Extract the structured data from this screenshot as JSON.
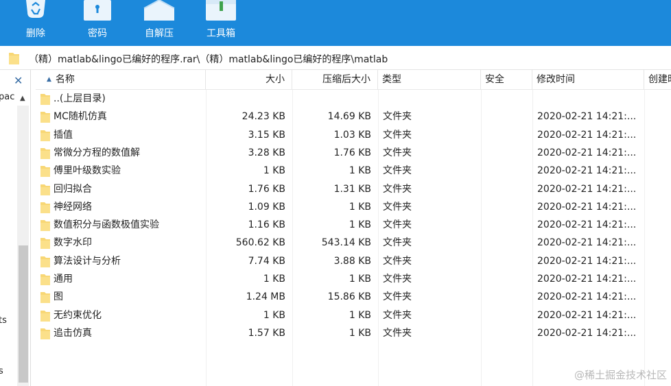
{
  "toolbar": {
    "buttons": [
      {
        "label": "删除",
        "icon": "recycle-bin-icon"
      },
      {
        "label": "密码",
        "icon": "lock-icon"
      },
      {
        "label": "自解压",
        "icon": "self-extract-icon"
      },
      {
        "label": "工具箱",
        "icon": "toolbox-icon"
      }
    ]
  },
  "colors": {
    "toolbar_bg": "#1c89db",
    "folder_yellow": "#f8d775"
  },
  "pathbar": {
    "path": "（精）matlab&lingo已编好的程序.rar\\（精）matlab&lingo已编好的程序\\matlab"
  },
  "leftpane": {
    "close": "✕",
    "text1": "pac",
    "text2": "ts",
    "text3": "s"
  },
  "columns": {
    "name": "名称",
    "size": "大小",
    "packed": "压缩后大小",
    "type": "类型",
    "security": "安全",
    "modified": "修改时间",
    "created": "创建时间"
  },
  "files": [
    {
      "name": "..(上层目录)",
      "size": "",
      "packed": "",
      "type": "",
      "modified": ""
    },
    {
      "name": "MC随机仿真",
      "size": "24.23 KB",
      "packed": "14.69 KB",
      "type": "文件夹",
      "modified": "2020-02-21 14:21:..."
    },
    {
      "name": "插值",
      "size": "3.15 KB",
      "packed": "1.03 KB",
      "type": "文件夹",
      "modified": "2020-02-21 14:21:..."
    },
    {
      "name": "常微分方程的数值解",
      "size": "3.28 KB",
      "packed": "1.76 KB",
      "type": "文件夹",
      "modified": "2020-02-21 14:21:..."
    },
    {
      "name": "傅里叶级数实验",
      "size": "1 KB",
      "packed": "1 KB",
      "type": "文件夹",
      "modified": "2020-02-21 14:21:..."
    },
    {
      "name": "回归拟合",
      "size": "1.76 KB",
      "packed": "1.31 KB",
      "type": "文件夹",
      "modified": "2020-02-21 14:21:..."
    },
    {
      "name": "神经网络",
      "size": "1.09 KB",
      "packed": "1 KB",
      "type": "文件夹",
      "modified": "2020-02-21 14:21:..."
    },
    {
      "name": "数值积分与函数极值实验",
      "size": "1.16 KB",
      "packed": "1 KB",
      "type": "文件夹",
      "modified": "2020-02-21 14:21:..."
    },
    {
      "name": "数字水印",
      "size": "560.62 KB",
      "packed": "543.14 KB",
      "type": "文件夹",
      "modified": "2020-02-21 14:21:..."
    },
    {
      "name": "算法设计与分析",
      "size": "7.74 KB",
      "packed": "3.88 KB",
      "type": "文件夹",
      "modified": "2020-02-21 14:21:..."
    },
    {
      "name": "通用",
      "size": "1 KB",
      "packed": "1 KB",
      "type": "文件夹",
      "modified": "2020-02-21 14:21:..."
    },
    {
      "name": "图",
      "size": "1.24 MB",
      "packed": "15.86 KB",
      "type": "文件夹",
      "modified": "2020-02-21 14:21:..."
    },
    {
      "name": "无约束优化",
      "size": "1 KB",
      "packed": "1 KB",
      "type": "文件夹",
      "modified": "2020-02-21 14:21:..."
    },
    {
      "name": "追击仿真",
      "size": "1.57 KB",
      "packed": "1 KB",
      "type": "文件夹",
      "modified": "2020-02-21 14:21:..."
    }
  ],
  "watermark": "@稀土掘金技术社区"
}
